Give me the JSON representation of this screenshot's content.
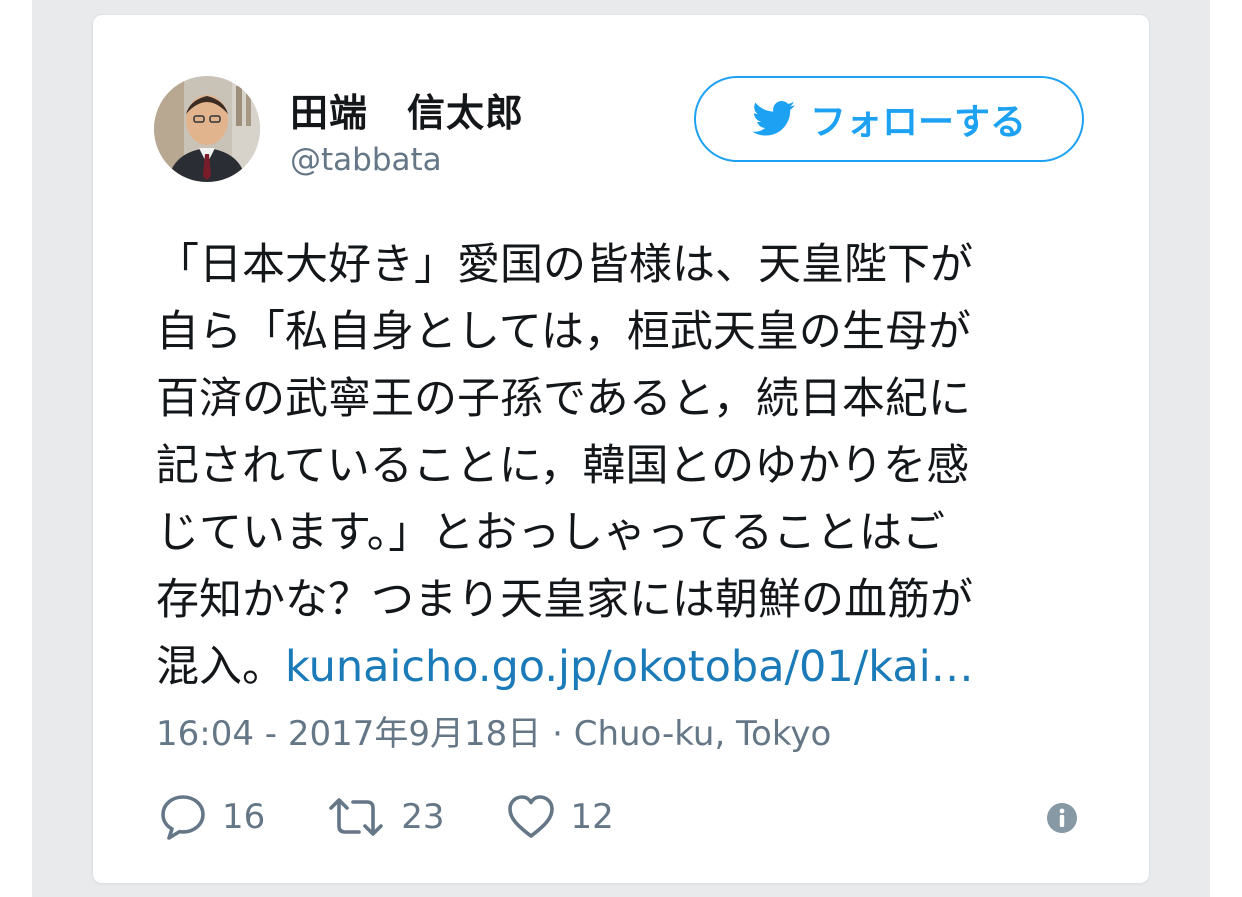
{
  "user": {
    "display_name": "田端　信太郎",
    "handle": "@tabbata"
  },
  "follow_button": {
    "label": "フォローする",
    "icon": "twitter-bird-icon"
  },
  "tweet": {
    "lines": [
      "「日本大好き」愛国の皆様は、天皇陛下が",
      "自ら「私自身としては，桓武天皇の生母が",
      "百済の武寧王の子孫であると，続日本紀に",
      "記されていることに，韓国とのゆかりを感",
      "じています。」とおっしゃってることはご",
      "存知かな？つまり天皇家には朝鮮の血筋が"
    ],
    "last_line_text": "混入。",
    "link": "kunaicho.go.jp/okotoba/01/kai…",
    "meta": "16:04 - 2017年9月18日 · Chuo-ku, Tokyo"
  },
  "actions": {
    "reply_count": "16",
    "retweet_count": "23",
    "like_count": "12"
  },
  "colors": {
    "accent": "#1da1f2",
    "link": "#1b7ab8",
    "secondary_text": "#657786",
    "primary_text": "#14171a"
  }
}
